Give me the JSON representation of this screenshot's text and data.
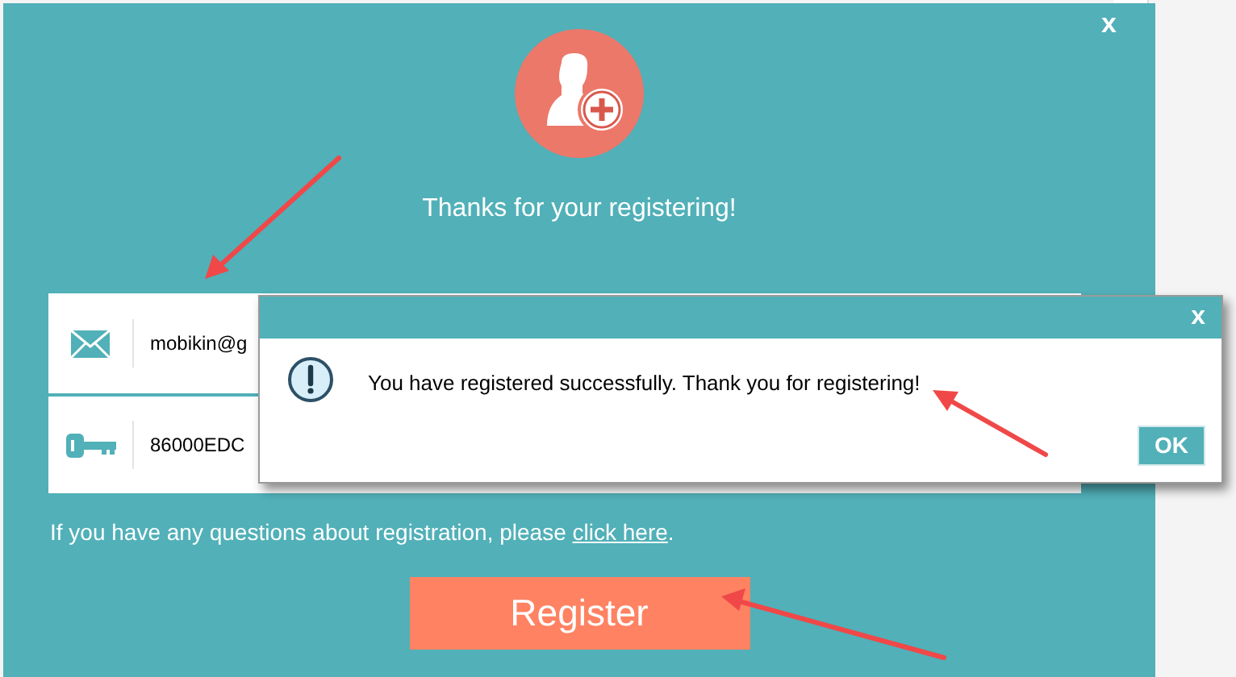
{
  "window": {
    "close": "x"
  },
  "heading": "Thanks for your registering!",
  "fields": [
    {
      "kind": "email",
      "value": "mobikin@g"
    },
    {
      "kind": "key",
      "value": "86000EDC"
    }
  ],
  "help": {
    "text": "If you have any questions about registration, please ",
    "link": "click here",
    "end": "."
  },
  "register_button": "Register",
  "dialog": {
    "close": "x",
    "message": "You have registered successfully. Thank you for registering!",
    "ok": "OK"
  }
}
